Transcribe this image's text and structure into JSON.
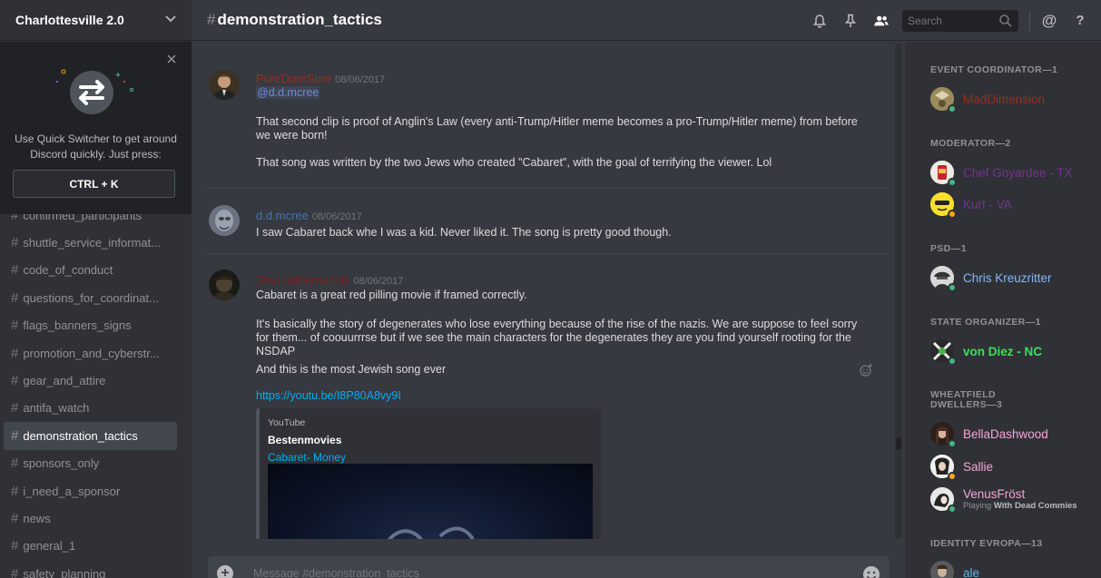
{
  "server": {
    "name": "Charlottesville 2.0"
  },
  "quick_switcher": {
    "text": "Use Quick Switcher to get around Discord quickly. Just press:",
    "shortcut": "CTRL + K"
  },
  "channels": [
    {
      "name": "confirmed_participants",
      "active": false
    },
    {
      "name": "shuttle_service_informat...",
      "active": false
    },
    {
      "name": "code_of_conduct",
      "active": false
    },
    {
      "name": "questions_for_coordinat...",
      "active": false
    },
    {
      "name": "flags_banners_signs",
      "active": false
    },
    {
      "name": "promotion_and_cyberstr...",
      "active": false
    },
    {
      "name": "gear_and_attire",
      "active": false
    },
    {
      "name": "antifa_watch",
      "active": false
    },
    {
      "name": "demonstration_tactics",
      "active": true
    },
    {
      "name": "sponsors_only",
      "active": false
    },
    {
      "name": "i_need_a_sponsor",
      "active": false
    },
    {
      "name": "news",
      "active": false
    },
    {
      "name": "general_1",
      "active": false
    },
    {
      "name": "safety_planning",
      "active": false
    }
  ],
  "header": {
    "channel": "demonstration_tactics",
    "search_placeholder": "Search"
  },
  "messages": [
    {
      "author": "PureDureSure",
      "color": "#992d22",
      "timestamp": "08/06/2017",
      "lines": [
        "@d.d.mcree",
        "That second clip is proof of Anglin's Law (every anti-Trump/Hitler meme becomes a pro-Trump/Hitler meme) from before we were born!",
        "That song was written by the two Jews who created \"Cabaret\", with the goal of terrifying the viewer. Lol"
      ]
    },
    {
      "author": "d.d.mcree",
      "color": "#3f77b6",
      "timestamp": "08/06/2017",
      "lines": [
        "I saw Cabaret back whe I was a kid. Never liked it. The song is pretty good though."
      ]
    },
    {
      "author": "Stannisthemannis",
      "color": "#7a2020",
      "timestamp": "08/06/2017",
      "lines": [
        "Cabaret is a great red pilling movie if framed correctly.",
        "It's basically the story of degenerates who lose everything because of the rise of the nazis.  We are suppose to feel sorry for them... of coouurrrse but if we see the main characters for the degenerates they are you find yourself rooting for the NSDAP",
        "And this is the most Jewish song ever",
        "https://youtu.be/I8P80A8vy9I"
      ],
      "embed": {
        "provider": "YouTube",
        "author": "Bestenmovies",
        "title": "Cabaret- Money"
      }
    }
  ],
  "composer": {
    "placeholder": "Message #demonstration_tactics"
  },
  "member_groups": [
    {
      "role": "EVENT COORDINATOR—1",
      "members": [
        {
          "name": "MadDimension",
          "color": "#992d22",
          "status": "online",
          "activity": ""
        }
      ]
    },
    {
      "role": "MODERATOR—2",
      "members": [
        {
          "name": "Chef Goyardee - TX",
          "color": "#71368a",
          "status": "online",
          "activity": ""
        },
        {
          "name": "Kurt - VA",
          "color": "#71368a",
          "status": "idle",
          "activity": ""
        }
      ]
    },
    {
      "role": "PSD—1",
      "members": [
        {
          "name": "Chris Kreuzritter",
          "color": "#8ab6f0",
          "status": "online",
          "activity": ""
        }
      ]
    },
    {
      "role": "STATE ORGANIZER—1",
      "members": [
        {
          "name": "von Diez - NC",
          "color": "#3ce05a",
          "status": "online",
          "activity": ""
        }
      ]
    },
    {
      "role": "WHEATFIELD DWELLERS—3",
      "members": [
        {
          "name": "BellaDashwood",
          "color": "#f3a6d8",
          "status": "online",
          "activity": ""
        },
        {
          "name": "Sallie",
          "color": "#f3a6d8",
          "status": "idle",
          "activity": ""
        },
        {
          "name": "VenusFröst",
          "color": "#f3a6d8",
          "status": "online",
          "activity_prefix": "Playing",
          "activity": "With Dead Commies"
        }
      ]
    },
    {
      "role": "IDENTITY EVROPA—13",
      "members": [
        {
          "name": "ale",
          "color": "#60aee6",
          "status": "online",
          "activity": ""
        }
      ]
    }
  ],
  "colors": {
    "online": "#43b581",
    "idle": "#faa61a",
    "mention": "#7289da",
    "link": "#00b0f4"
  }
}
